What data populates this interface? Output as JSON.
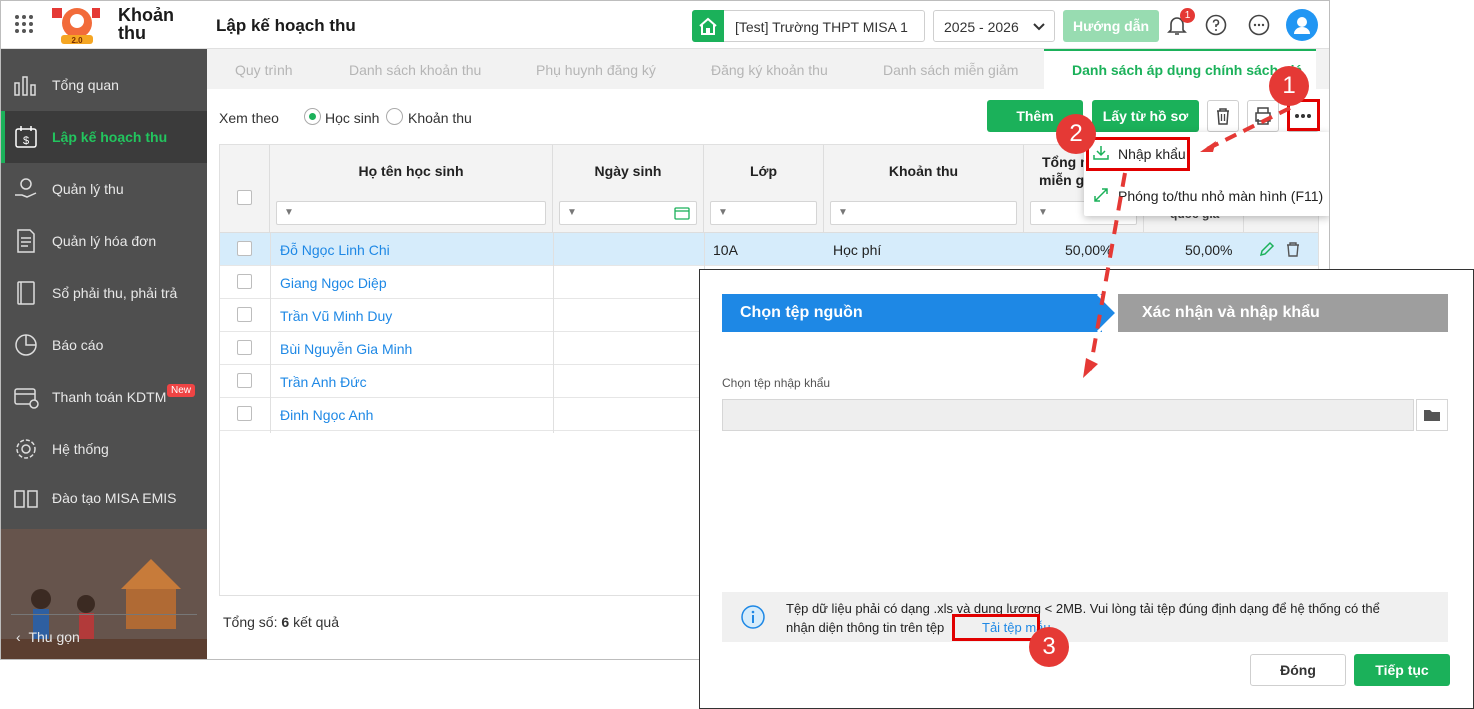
{
  "header": {
    "app_name_line1": "Khoản",
    "app_name_line2": "thu",
    "page_title": "Lập kế hoạch thu",
    "school": "[Test] Trường THPT MISA 1",
    "year": "2025 - 2026",
    "guide": "Hướng dẫn",
    "notification_count": "1"
  },
  "sidebar": {
    "items": [
      {
        "label": "Tổng quan",
        "icon": "chart-bars-icon"
      },
      {
        "label": "Lập kế hoạch thu",
        "icon": "calendar-dollar-icon"
      },
      {
        "label": "Quản lý thu",
        "icon": "hand-coin-icon"
      },
      {
        "label": "Quản lý hóa đơn",
        "icon": "invoice-icon"
      },
      {
        "label": "Sổ phải thu, phải trả",
        "icon": "ledger-book-icon"
      },
      {
        "label": "Báo cáo",
        "icon": "pie-chart-icon"
      },
      {
        "label": "Thanh toán KDTM",
        "icon": "card-payment-icon"
      },
      {
        "label": "Hệ thống",
        "icon": "gear-icon"
      },
      {
        "label": "Đào tạo MISA EMIS",
        "icon": "open-book-icon"
      }
    ],
    "new_badge": "New",
    "collapse": "Thu gọn"
  },
  "tabs": [
    "Quy trình",
    "Danh sách khoản thu",
    "Phụ huynh đăng ký",
    "Đăng ký khoản thu",
    "Danh sách miễn giảm",
    "Danh sách áp dụng chính sách giá"
  ],
  "toolbar": {
    "view_by": "Xem theo",
    "option_student": "Học sinh",
    "option_fee": "Khoản thu",
    "add": "Thêm",
    "from_profile": "Lấy từ hồ sơ"
  },
  "table": {
    "columns": [
      "Họ tên học sinh",
      "Ngày sinh",
      "Lớp",
      "Khoản thu",
      "Tổng m",
      "miễn gi"
    ],
    "hidden_fragment": "quốc gia",
    "rows": [
      {
        "name": "Đỗ Ngọc Linh Chi",
        "class": "10A",
        "fee": "Học phí",
        "pct1": "50,00%",
        "pct2": "50,00%"
      },
      {
        "name": "Giang Ngọc Diệp"
      },
      {
        "name": "Trần Vũ Minh Duy"
      },
      {
        "name": "Bùi Nguyễn Gia Minh"
      },
      {
        "name": "Trần Anh Đức"
      },
      {
        "name": "Đinh Ngọc Anh"
      }
    ],
    "total_prefix": "Tổng số:",
    "total_count": "6",
    "total_suffix": "kết quả"
  },
  "menu": {
    "import": "Nhập khẩu",
    "fullscreen": "Phóng to/thu nhỏ màn hình (F11)"
  },
  "dialog": {
    "step1": "Chọn tệp nguồn",
    "step2": "Xác nhận và nhập khẩu",
    "field_label": "Chọn tệp nhập khẩu",
    "note_line1": "Tệp dữ liệu phải có dạng .xls và dung lượng < 2MB. Vui lòng tải tệp đúng định dạng để hệ thống có thể",
    "note_line2": "nhận diện thông tin trên tệp",
    "download_template": "Tải tệp mẫu",
    "close": "Đóng",
    "next": "Tiếp tục"
  },
  "annotations": {
    "step1": "1",
    "step2": "2",
    "step3": "3"
  },
  "colors": {
    "accent": "#1bb15a",
    "link": "#1e88e5",
    "sidebar": "#4f4f4f",
    "highlight": "#e10000"
  }
}
